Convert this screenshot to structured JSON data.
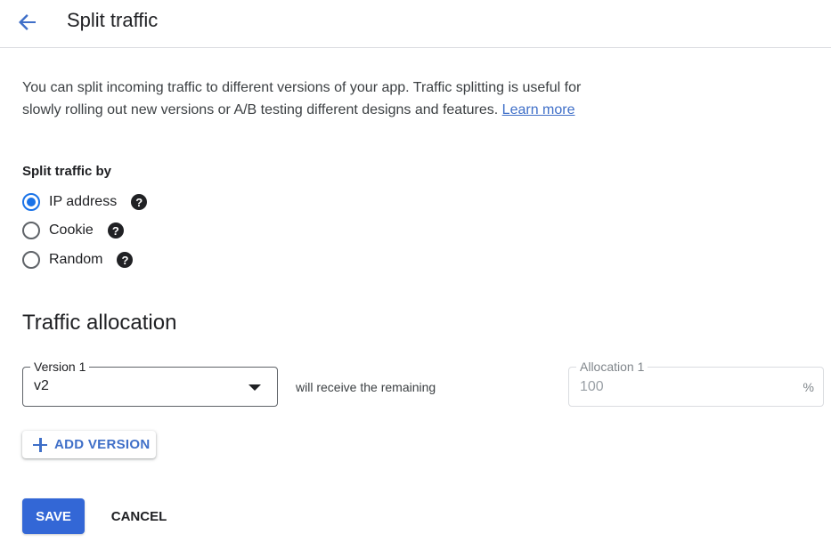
{
  "header": {
    "back_icon": "arrow-left-icon",
    "title": "Split traffic"
  },
  "intro": {
    "text": "You can split incoming traffic to different versions of your app. Traffic splitting is useful for slowly rolling out new versions or A/B testing different designs and features. ",
    "link_label": "Learn more"
  },
  "split_by": {
    "label": "Split traffic by",
    "selected": "IP address",
    "options": [
      {
        "label": "IP address",
        "help_icon": "help-circle-icon",
        "help_glyph": "?"
      },
      {
        "label": "Cookie",
        "help_icon": "help-circle-icon",
        "help_glyph": "?"
      },
      {
        "label": "Random",
        "help_icon": "help-circle-icon",
        "help_glyph": "?"
      }
    ]
  },
  "allocation": {
    "heading": "Traffic allocation",
    "version_select": {
      "legend": "Version 1",
      "value": "v2"
    },
    "remaining_text": "will receive the remaining",
    "allocation_field": {
      "legend": "Allocation 1",
      "value": "100",
      "unit": "%"
    },
    "add_version_label": "ADD VERSION"
  },
  "actions": {
    "save_label": "SAVE",
    "cancel_label": "CANCEL"
  },
  "colors": {
    "accent": "#1a73e8",
    "link": "#3f6fc8",
    "primary_button": "#3367d6",
    "divider": "#dadce0"
  }
}
